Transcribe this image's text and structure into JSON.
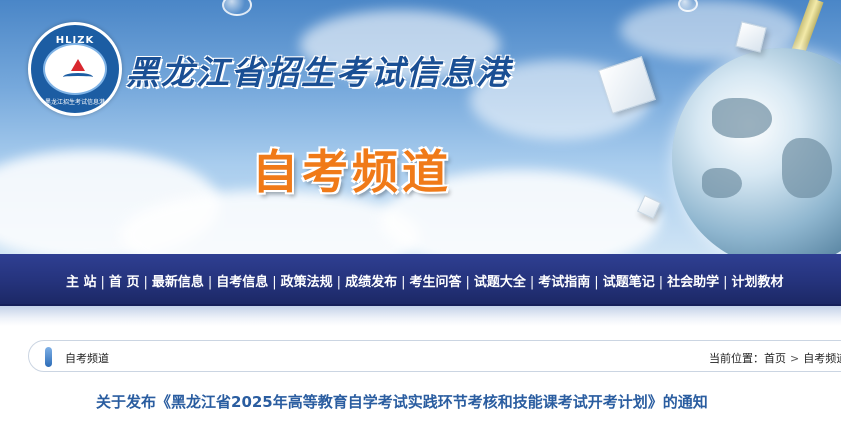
{
  "header": {
    "logo_top_text": "HLJZK",
    "logo_bottom_text": "黑龙江招生考试信息港",
    "site_title": "黑龙江省招生考试信息港",
    "channel_title": "自考频道"
  },
  "nav": {
    "items": [
      "主 站",
      "首 页",
      "最新信息",
      "自考信息",
      "政策法规",
      "成绩发布",
      "考生问答",
      "试题大全",
      "考试指南",
      "试题笔记",
      "社会助学",
      "计划教材"
    ],
    "separator": "|"
  },
  "breadcrumb": {
    "section": "自考频道",
    "location_label": "当前位置：",
    "path": [
      "首页",
      "自考频道"
    ],
    "arrow": ">"
  },
  "article": {
    "title": "关于发布《黑龙江省2025年高等教育自学考试实践环节考核和技能课考试开考计划》的通知"
  },
  "colors": {
    "nav_bg": "#24327a",
    "title_blue": "#1a4f94",
    "channel_orange": "#f07a18",
    "headline_blue": "#2a5da0"
  }
}
